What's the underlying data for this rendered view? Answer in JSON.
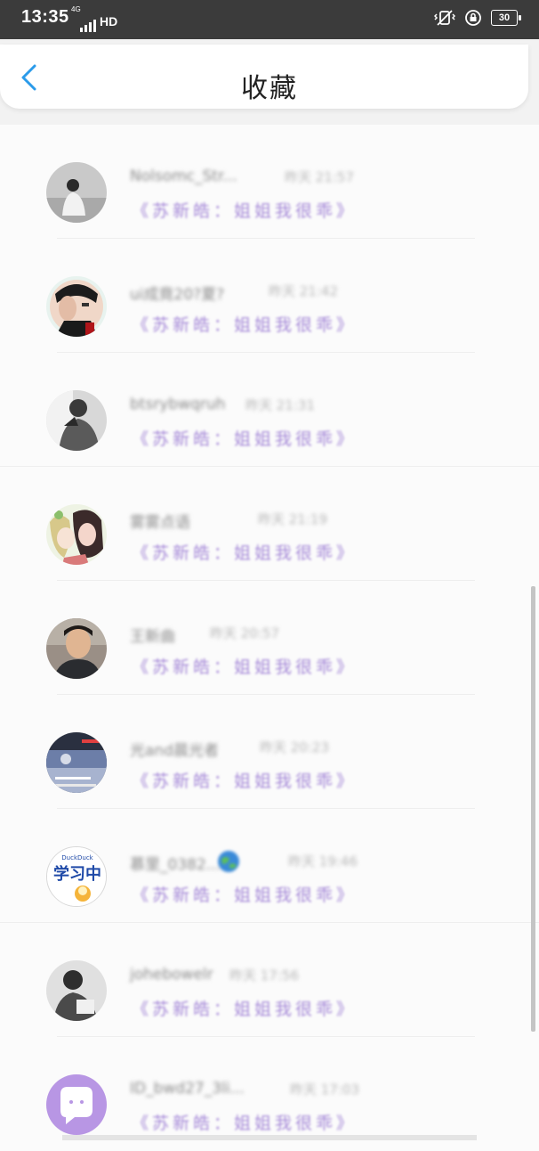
{
  "status_bar": {
    "time": "13:35",
    "network": "4G",
    "hd": "HD",
    "battery": "30"
  },
  "header": {
    "title": "收藏"
  },
  "items": [
    {
      "name": "Nolsomc_Str...",
      "time": "昨天 21:57",
      "song": "《苏新皓：姐姐我很乖》",
      "avatar": "person-gray"
    },
    {
      "name": "ui成竟20?夏?",
      "time": "昨天 21:42",
      "song": "《苏新皓：姐姐我很乖》",
      "avatar": "person-hand"
    },
    {
      "name": "btsrybwqruh",
      "time": "昨天 21:31",
      "song": "《苏新皓：姐姐我很乖》",
      "avatar": "person-bw"
    },
    {
      "name": "雾雾点语",
      "time": "昨天 21:19",
      "song": "《苏新皓：姐姐我很乖》",
      "avatar": "cartoon-couple"
    },
    {
      "name": "王新曲",
      "time": "昨天 20:57",
      "song": "《苏新皓：姐姐我很乖》",
      "avatar": "boy-photo"
    },
    {
      "name": "光and晨光者",
      "time": "昨天 20:23",
      "song": "《苏新皓：姐姐我很乖》",
      "avatar": "dark-collage"
    },
    {
      "name": "慕里_0382...",
      "time": "昨天 19:46",
      "song": "《苏新皓：姐姐我很乖》",
      "avatar": "study-duck"
    },
    {
      "name": "johebowelr",
      "time": "昨天 17:56",
      "song": "《苏新皓：姐姐我很乖》",
      "avatar": "person-bw2"
    },
    {
      "name": "ID_bwd27_3li...",
      "time": "昨天 17:03",
      "song": "《苏新皓：姐姐我很乖》",
      "avatar": "chat-bubble"
    }
  ],
  "colors": {
    "accent": "#2b9bea",
    "song_purple": "#a68ad8"
  }
}
